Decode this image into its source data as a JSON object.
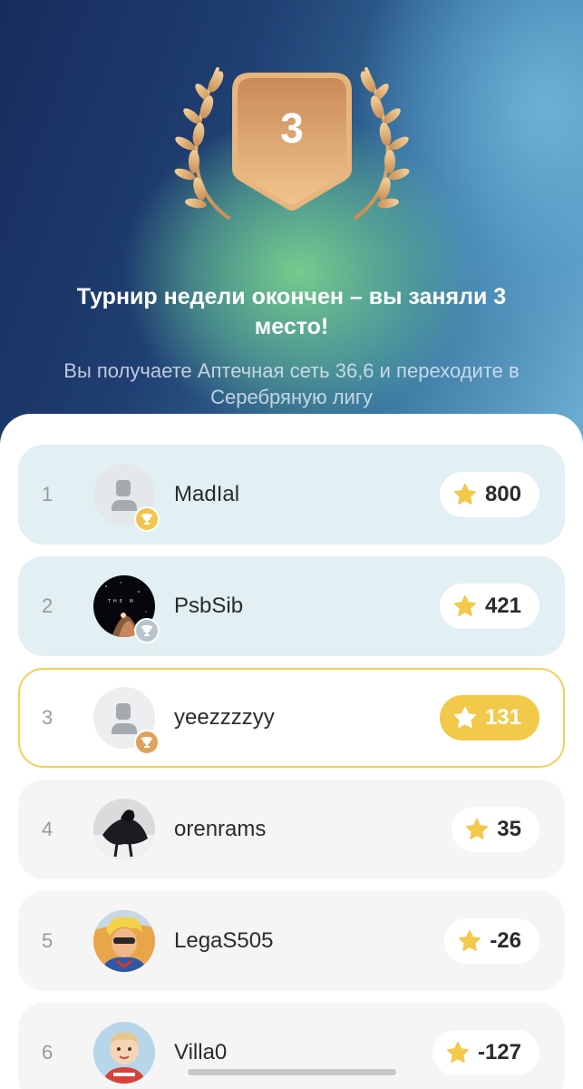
{
  "result": {
    "place": "3",
    "headline": "Турнир недели окончен – вы заняли 3 место!",
    "subline": "Вы получаете Аптечная сеть 36,6 и переходите в Серебряную лигу"
  },
  "colors": {
    "accent_gold": "#f2c94a",
    "badge_bronze": "#d9a066",
    "highlight_row": "#e2eff3"
  },
  "leaderboard": [
    {
      "rank": "1",
      "name": "MadIal",
      "score": "800",
      "avatar": "default-avatar-icon",
      "trophy": "gold-trophy-icon"
    },
    {
      "rank": "2",
      "name": "PsbSib",
      "score": "421",
      "avatar": "space-photo-avatar",
      "trophy": "silver-trophy-icon"
    },
    {
      "rank": "3",
      "name": "yeezzzzyy",
      "score": "131",
      "avatar": "default-avatar-icon",
      "trophy": "bronze-trophy-icon"
    },
    {
      "rank": "4",
      "name": "orenrams",
      "score": "35",
      "avatar": "dark-figure-photo-avatar"
    },
    {
      "rank": "5",
      "name": "LegaS505",
      "score": "-26",
      "avatar": "comic-character-avatar"
    },
    {
      "rank": "6",
      "name": "Villa0",
      "score": "-127",
      "avatar": "child-photo-avatar"
    }
  ]
}
